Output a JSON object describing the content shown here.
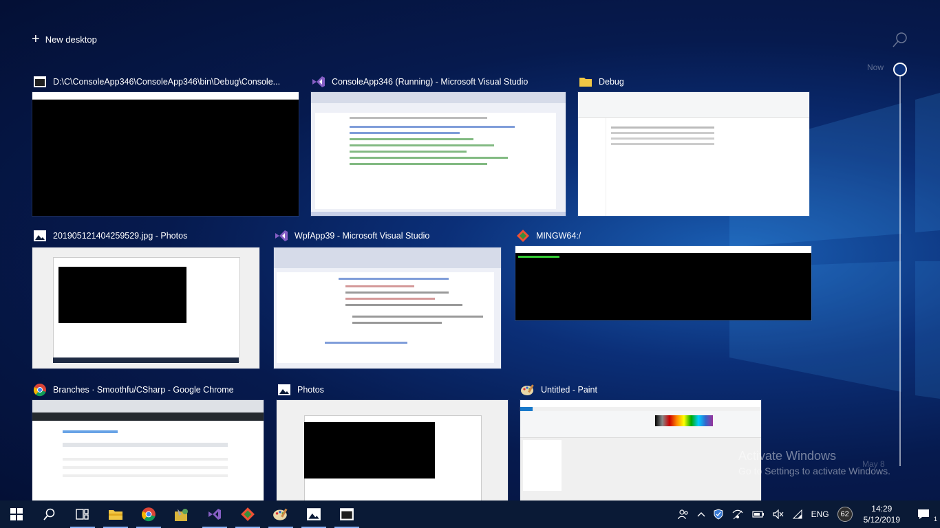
{
  "header": {
    "new_desktop_label": "New desktop"
  },
  "timeline": {
    "now_label": "Now",
    "earlier_label": "May 8"
  },
  "watermark": {
    "line1": "Activate Windows",
    "line2": "Go to Settings to activate Windows."
  },
  "windows": [
    {
      "title": "D:\\C\\ConsoleApp346\\ConsoleApp346\\bin\\Debug\\Console...",
      "icon": "console-icon"
    },
    {
      "title": "ConsoleApp346 (Running) - Microsoft Visual Studio",
      "icon": "visual-studio-icon"
    },
    {
      "title": "Debug",
      "icon": "folder-icon"
    },
    {
      "title": "201905121404259529.jpg - Photos",
      "icon": "photos-icon"
    },
    {
      "title": "WpfApp39 - Microsoft Visual Studio",
      "icon": "visual-studio-icon"
    },
    {
      "title": "MINGW64:/",
      "icon": "git-bash-icon"
    },
    {
      "title": "Branches · Smoothfu/CSharp - Google Chrome",
      "icon": "chrome-icon"
    },
    {
      "title": "Photos",
      "icon": "photos-icon"
    },
    {
      "title": "Untitled - Paint",
      "icon": "paint-icon"
    }
  ],
  "taskbar": {
    "apps": [
      "start-icon",
      "search-icon",
      "task-view-icon",
      "file-explorer-icon",
      "chrome-icon",
      "tools-icon",
      "visual-studio-icon",
      "git-icon",
      "paint-icon",
      "photos-icon",
      "console-icon"
    ],
    "tray": {
      "language": "ENG",
      "battery_badge": "62",
      "time": "14:29",
      "date": "5/12/2019",
      "notifications": "1"
    }
  },
  "colors": {
    "accent": "#8ab4f8",
    "taskbar": "#0a1a36",
    "vs_purple": "#865fc5"
  }
}
